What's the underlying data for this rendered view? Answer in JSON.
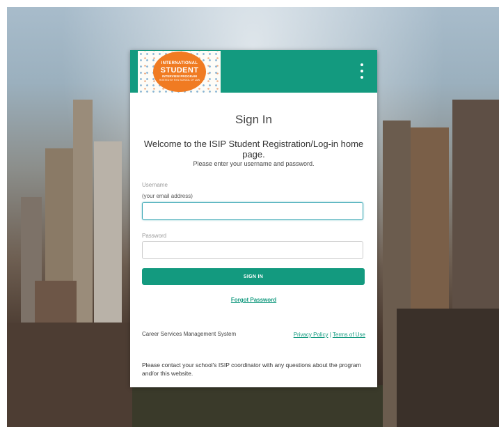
{
  "logo": {
    "line1": "INTERNATIONAL",
    "line2": "STUDENT",
    "line3": "INTERVIEW PROGRAM",
    "line4": "HOSTED BY NYU SCHOOL OF LAW"
  },
  "header": {
    "menu_icon": "vertical-dots-icon"
  },
  "signin": {
    "title": "Sign In",
    "welcome": "Welcome to the ISIP Student Registration/Log-in home page.",
    "instructions": "Please enter your username and password.",
    "username_label": "Username",
    "username_hint": "(your email address)",
    "username_value": "",
    "password_label": "Password",
    "password_value": "",
    "button_label": "SIGN IN",
    "forgot_label": "Forgot Password"
  },
  "footer": {
    "system_name": "Career Services Management System",
    "privacy_label": "Privacy Policy",
    "separator": "|",
    "terms_label": "Terms of Use",
    "contact": "Please contact your school's ISIP coordinator with any questions about the program and/or this website."
  },
  "colors": {
    "accent": "#139a7f",
    "logo_orange": "#f07b22"
  }
}
